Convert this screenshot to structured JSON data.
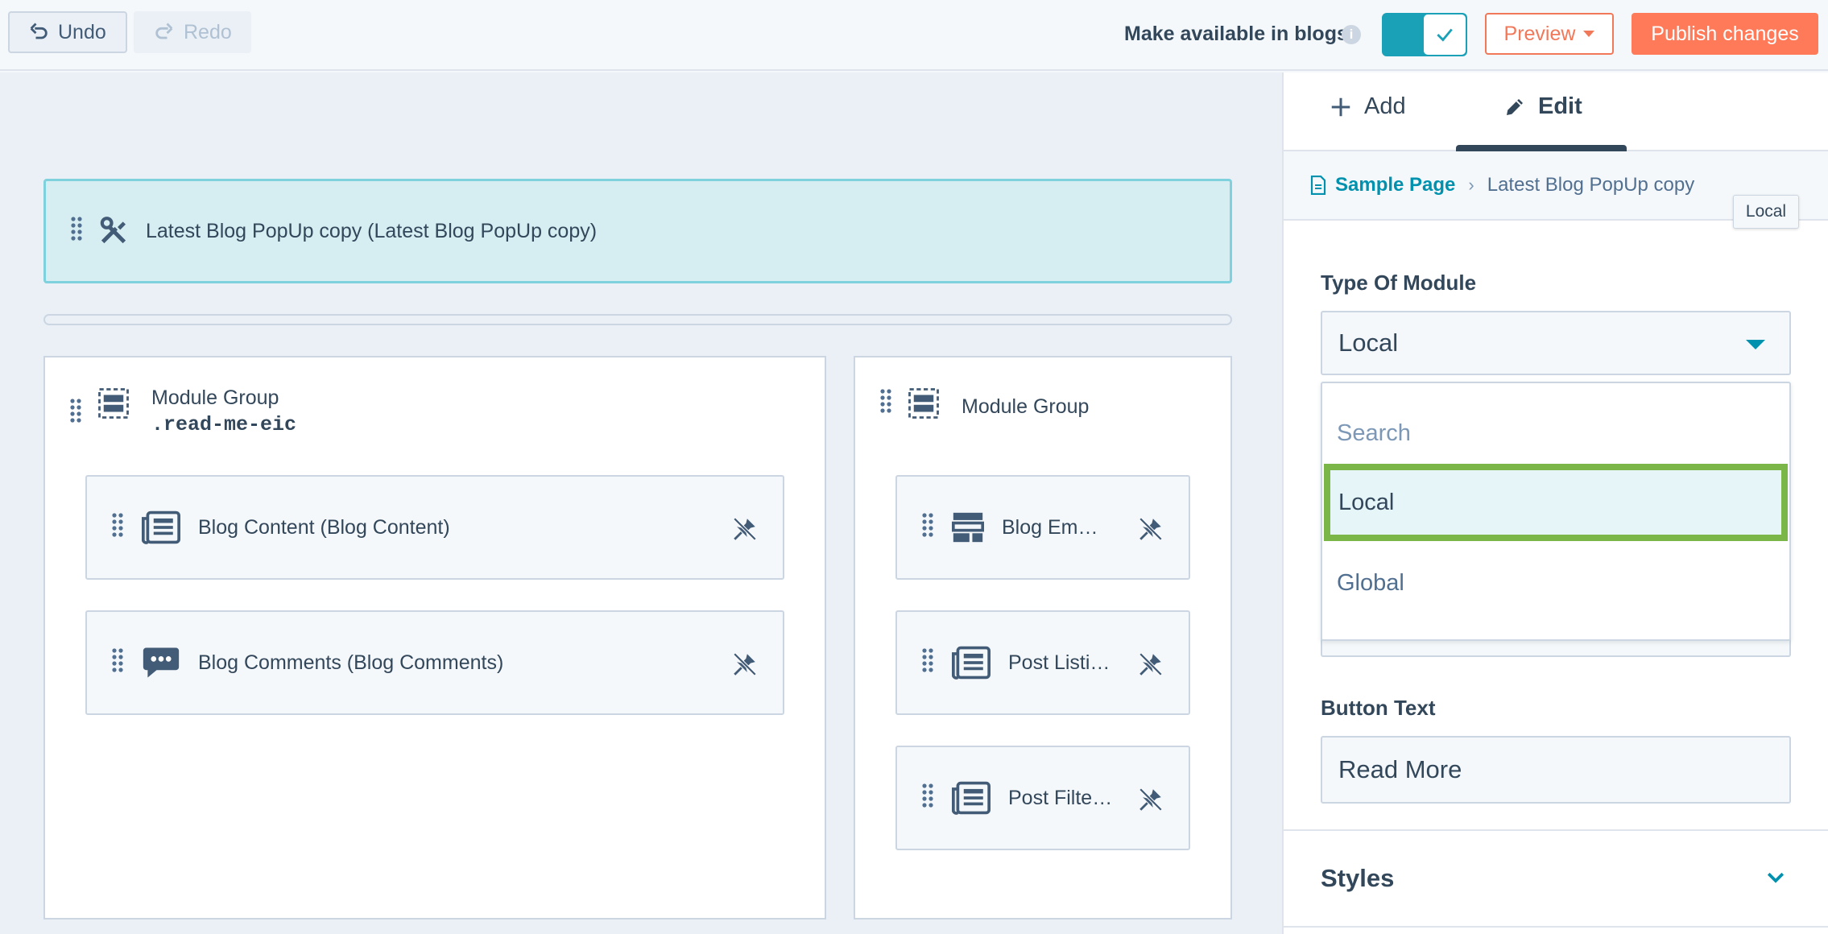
{
  "toolbar": {
    "undo_label": "Undo",
    "redo_label": "Redo",
    "availability_label": "Make available in blogs",
    "availability_enabled": true,
    "preview_label": "Preview",
    "publish_label": "Publish changes"
  },
  "canvas": {
    "banner_label": "Latest Blog PopUp copy (Latest Blog PopUp copy)",
    "left_group": {
      "title": "Module Group",
      "class_name": ".read-me-eic",
      "modules": [
        {
          "label": "Blog Content (Blog Content)",
          "icon": "blog-content-icon"
        },
        {
          "label": "Blog Comments (Blog Comments)",
          "icon": "comments-icon"
        }
      ]
    },
    "right_group": {
      "title": "Module Group",
      "modules": [
        {
          "label": "Blog Em…",
          "icon": "blog-email-icon"
        },
        {
          "label": "Post Listi…",
          "icon": "post-listing-icon"
        },
        {
          "label": "Post Filte…",
          "icon": "post-filter-icon"
        }
      ]
    }
  },
  "panel": {
    "tabs": [
      {
        "label": "Add",
        "icon": "plus-icon"
      },
      {
        "label": "Edit",
        "icon": "pencil-icon",
        "active": true
      }
    ],
    "breadcrumb": {
      "root": "Sample Page",
      "current": "Latest Blog PopUp copy"
    },
    "tooltip": "Local",
    "type_of_module": {
      "label": "Type Of Module",
      "value": "Local",
      "options": [
        "Search",
        "Local",
        "Global"
      ],
      "highlighted": "Local"
    },
    "button_text": {
      "label": "Button Text",
      "value": "Read More"
    },
    "styles_label": "Styles"
  },
  "colors": {
    "accent_teal": "#1aa1b8",
    "publish_orange": "#ff7a59",
    "highlight_green": "#7ab648",
    "text_dark": "#33475b"
  }
}
